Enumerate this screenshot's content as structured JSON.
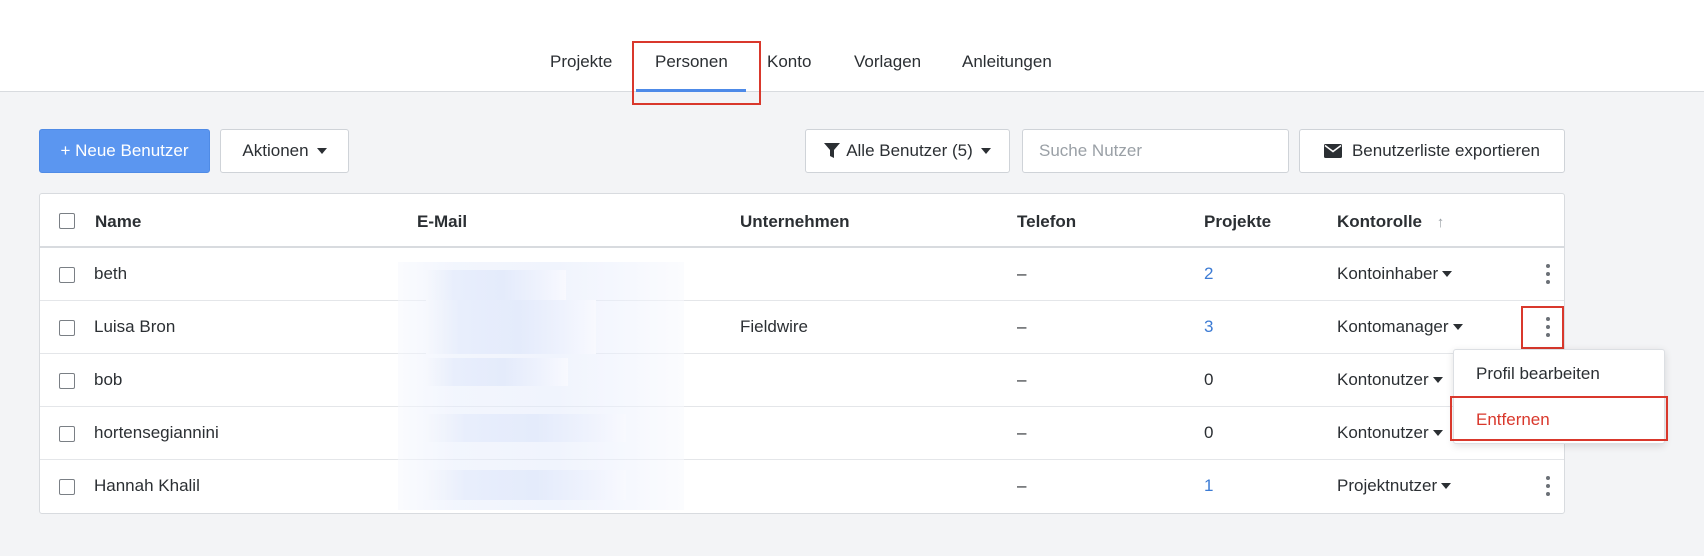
{
  "nav": {
    "tabs": [
      {
        "label": "Projekte"
      },
      {
        "label": "Personen"
      },
      {
        "label": "Konto"
      },
      {
        "label": "Vorlagen"
      },
      {
        "label": "Anleitungen"
      }
    ],
    "active_tab": "Personen"
  },
  "toolbar": {
    "new_user_label": "+ Neue Benutzer",
    "actions_label": "Aktionen",
    "filter_label": "Alle Benutzer (5)",
    "search_placeholder": "Suche Nutzer",
    "export_label": "Benutzerliste exportieren"
  },
  "table": {
    "columns": [
      "Name",
      "E-Mail",
      "Unternehmen",
      "Telefon",
      "Projekte",
      "Kontorolle"
    ],
    "sort_column": "Kontorolle",
    "sort_direction": "ascending",
    "rows": [
      {
        "name": "beth",
        "email": "",
        "company": "",
        "phone": "–",
        "projects": "2",
        "role": "Kontoinhaber"
      },
      {
        "name": "Luisa Bron",
        "email": "",
        "company": "Fieldwire",
        "phone": "–",
        "projects": "3",
        "role": "Kontomanager"
      },
      {
        "name": "bob",
        "email": "",
        "company": "",
        "phone": "–",
        "projects": "0",
        "role": "Kontonutzer"
      },
      {
        "name": "hortensegiannini",
        "email": "",
        "company": "",
        "phone": "–",
        "projects": "0",
        "role": "Kontonutzer"
      },
      {
        "name": "Hannah Khalil",
        "email": "",
        "company": "",
        "phone": "–",
        "projects": "1",
        "role": "Projektnutzer"
      }
    ]
  },
  "context_menu": {
    "items": [
      {
        "label": "Profil bearbeiten",
        "color": "#2b2f33"
      },
      {
        "label": "Entfernen",
        "color": "#d9382c"
      }
    ]
  },
  "colors": {
    "primary": "#5b96f0",
    "link": "#3c7bd4",
    "danger": "#d9382c",
    "highlight": "#d9382c"
  },
  "icons": [
    "filter-icon",
    "envelope-icon",
    "caret-down-icon",
    "sort-arrow-up-icon",
    "more-vertical-icon"
  ]
}
